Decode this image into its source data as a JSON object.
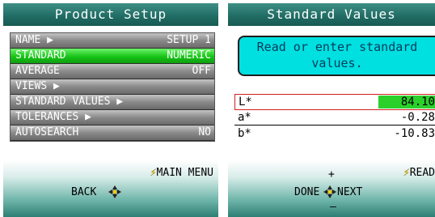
{
  "left": {
    "title": "Product Setup",
    "menu": [
      {
        "label": "NAME ▶",
        "value": "SETUP 1"
      },
      {
        "label": "STANDARD",
        "value": "NUMERIC"
      },
      {
        "label": "AVERAGE",
        "value": "OFF"
      },
      {
        "label": "VIEWS ▶",
        "value": ""
      },
      {
        "label": "STANDARD VALUES ▶",
        "value": ""
      },
      {
        "label": "TOLERANCES ▶",
        "value": ""
      },
      {
        "label": "AUTOSEARCH",
        "value": "NO"
      }
    ],
    "footer": {
      "right_label": "MAIN MENU",
      "left_label": "BACK"
    }
  },
  "right": {
    "title": "Standard Values",
    "info_line1": "Read or enter standard",
    "info_line2": "values.",
    "rows": [
      {
        "name": "L*",
        "value": "84.10"
      },
      {
        "name": "a*",
        "value": "-0.28"
      },
      {
        "name": "b*",
        "value": "-10.83"
      }
    ],
    "footer": {
      "plus": "+",
      "minus": "–",
      "done_label": "DONE",
      "next_label": "NEXT",
      "read_label": "READ"
    }
  },
  "colors": {
    "title_bar": "#1f6b63",
    "selected": "#18c418",
    "info_box": "#00e0e0",
    "bolt": "#ffd400"
  },
  "icons": [
    "lightning-icon",
    "dpad-icon"
  ]
}
